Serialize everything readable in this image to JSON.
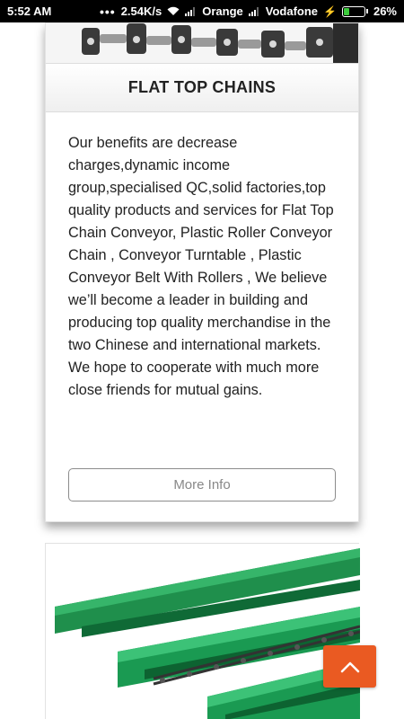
{
  "status_bar": {
    "time": "5:52 AM",
    "speed": "2.54K/s",
    "carrier1": "Orange",
    "carrier2": "Vodafone",
    "battery": "26%",
    "battery_level": 0.26
  },
  "card1": {
    "title": "FLAT TOP CHAINS",
    "description": "Our benefits are decrease charges,dynamic income group,specialised QC,solid factories,top quality products and services for Flat Top Chain Conveyor, Plastic Roller Conveyor Chain , Conveyor Turntable , Plastic Conveyor Belt With Rollers , We believe we’ll become a leader in building and producing top quality merchandise in the two Chinese and international markets. We hope to cooperate with much more close friends for mutual gains.",
    "button_label": "More Info"
  },
  "card2": {
    "image": "green-guide-rails-with-chain"
  },
  "scroll_top": {
    "icon": "chevron-up-icon"
  },
  "colors": {
    "accent": "#ea5a22",
    "rail_green": "#1a9a52"
  }
}
